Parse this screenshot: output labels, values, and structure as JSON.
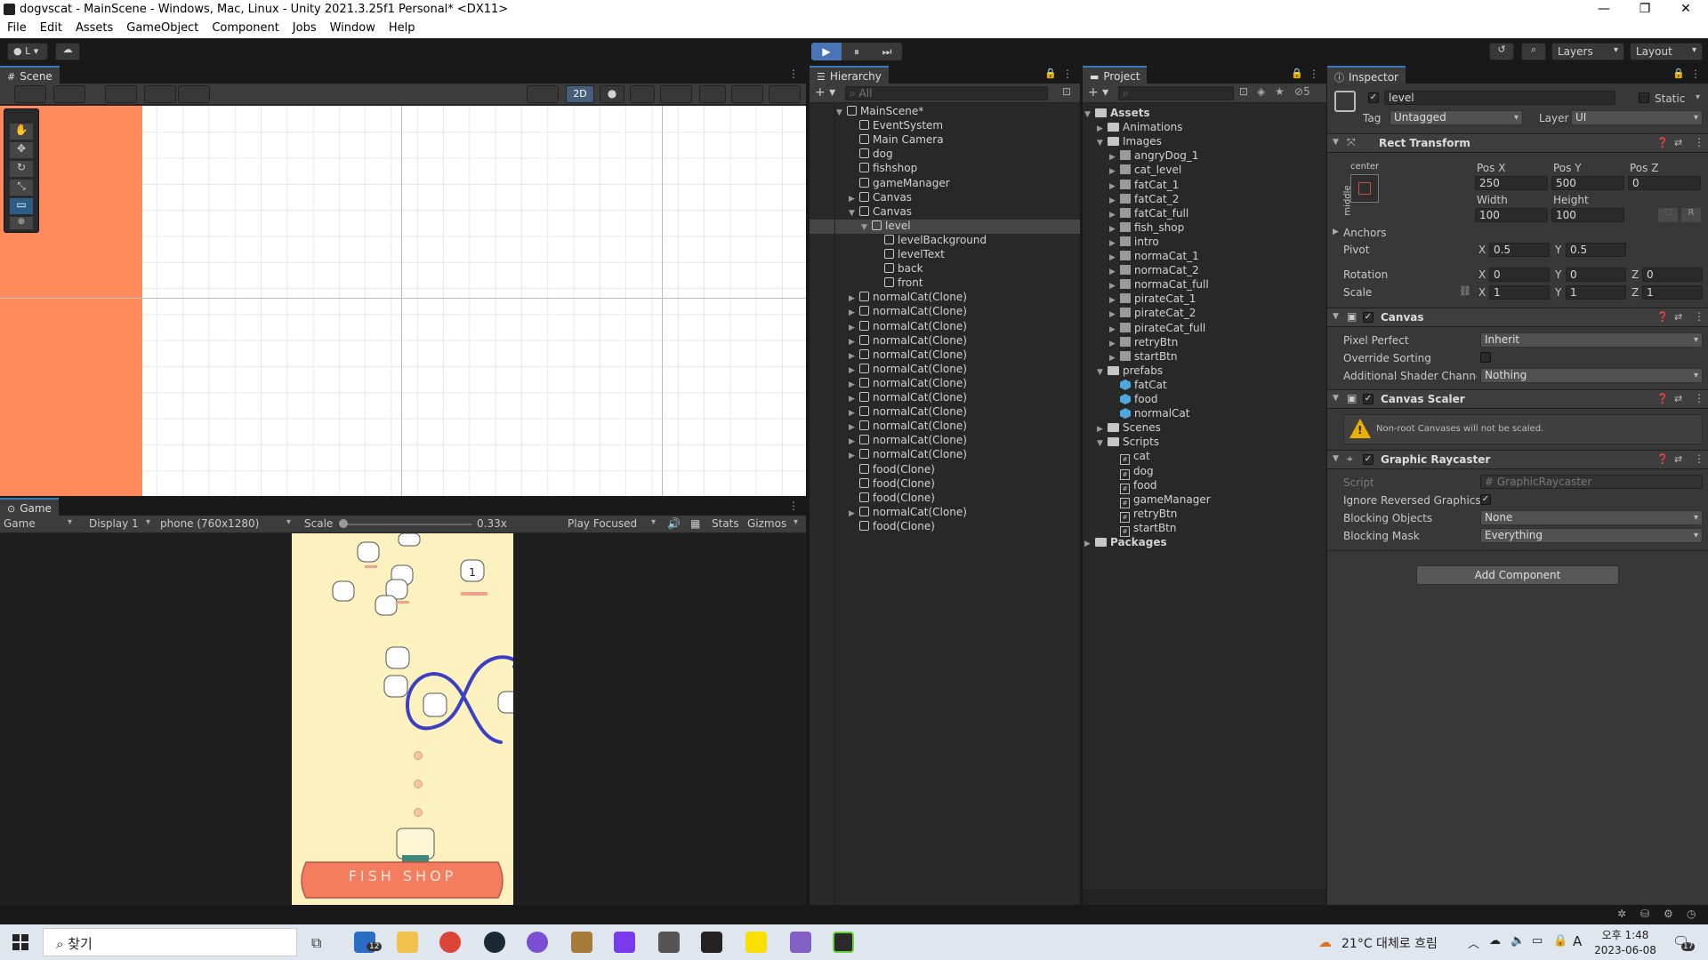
{
  "window": {
    "title": "dogvscat - MainScene - Windows, Mac, Linux - Unity 2021.3.25f1 Personal* <DX11>",
    "controls": [
      "—",
      "❐",
      "✕"
    ]
  },
  "menu": [
    "File",
    "Edit",
    "Assets",
    "GameObject",
    "Component",
    "Jobs",
    "Window",
    "Help"
  ],
  "toolbar": {
    "account": "L",
    "play": "▶",
    "pause": "⏸",
    "step": "⏭",
    "layers": "Layers",
    "layout": "Layout"
  },
  "scene": {
    "tab": "Scene",
    "mode_2d": "2D"
  },
  "game": {
    "tab": "Game",
    "view": "Game",
    "display": "Display 1",
    "resolution": "phone (760x1280)",
    "scale_label": "Scale",
    "scale_value": "0.33x",
    "play_focused": "Play Focused",
    "stats": "Stats",
    "gizmos": "Gizmos",
    "score": "1",
    "shop_label": "FISH   SHOP"
  },
  "hierarchy": {
    "tab": "Hierarchy",
    "search_placeholder": "All",
    "items": [
      {
        "label": "MainScene*",
        "depth": 0,
        "type": "scene",
        "expanded": true
      },
      {
        "label": "EventSystem",
        "depth": 1,
        "type": "go"
      },
      {
        "label": "Main Camera",
        "depth": 1,
        "type": "go"
      },
      {
        "label": "dog",
        "depth": 1,
        "type": "go"
      },
      {
        "label": "fishshop",
        "depth": 1,
        "type": "go"
      },
      {
        "label": "gameManager",
        "depth": 1,
        "type": "go"
      },
      {
        "label": "Canvas",
        "depth": 1,
        "type": "go",
        "collapsed": true
      },
      {
        "label": "Canvas",
        "depth": 1,
        "type": "go",
        "expanded": true
      },
      {
        "label": "level",
        "depth": 2,
        "type": "go",
        "expanded": true,
        "selected": true
      },
      {
        "label": "levelBackground",
        "depth": 3,
        "type": "go"
      },
      {
        "label": "levelText",
        "depth": 3,
        "type": "go"
      },
      {
        "label": "back",
        "depth": 3,
        "type": "go"
      },
      {
        "label": "front",
        "depth": 3,
        "type": "go"
      },
      {
        "label": "normalCat(Clone)",
        "depth": 1,
        "type": "go",
        "collapsed": true
      },
      {
        "label": "normalCat(Clone)",
        "depth": 1,
        "type": "go",
        "collapsed": true
      },
      {
        "label": "normalCat(Clone)",
        "depth": 1,
        "type": "go",
        "collapsed": true
      },
      {
        "label": "normalCat(Clone)",
        "depth": 1,
        "type": "go",
        "collapsed": true
      },
      {
        "label": "normalCat(Clone)",
        "depth": 1,
        "type": "go",
        "collapsed": true
      },
      {
        "label": "normalCat(Clone)",
        "depth": 1,
        "type": "go",
        "collapsed": true
      },
      {
        "label": "normalCat(Clone)",
        "depth": 1,
        "type": "go",
        "collapsed": true
      },
      {
        "label": "normalCat(Clone)",
        "depth": 1,
        "type": "go",
        "collapsed": true
      },
      {
        "label": "normalCat(Clone)",
        "depth": 1,
        "type": "go",
        "collapsed": true
      },
      {
        "label": "normalCat(Clone)",
        "depth": 1,
        "type": "go",
        "collapsed": true
      },
      {
        "label": "normalCat(Clone)",
        "depth": 1,
        "type": "go",
        "collapsed": true
      },
      {
        "label": "normalCat(Clone)",
        "depth": 1,
        "type": "go",
        "collapsed": true
      },
      {
        "label": "food(Clone)",
        "depth": 1,
        "type": "go"
      },
      {
        "label": "food(Clone)",
        "depth": 1,
        "type": "go"
      },
      {
        "label": "food(Clone)",
        "depth": 1,
        "type": "go"
      },
      {
        "label": "normalCat(Clone)",
        "depth": 1,
        "type": "go",
        "collapsed": true
      },
      {
        "label": "food(Clone)",
        "depth": 1,
        "type": "go"
      }
    ]
  },
  "project": {
    "tab": "Project",
    "badge": "5",
    "items": [
      {
        "label": "Assets",
        "depth": 0,
        "type": "folder",
        "expanded": true,
        "bold": true
      },
      {
        "label": "Animations",
        "depth": 1,
        "type": "folder",
        "collapsed": true
      },
      {
        "label": "Images",
        "depth": 1,
        "type": "folder",
        "expanded": true
      },
      {
        "label": "angryDog_1",
        "depth": 2,
        "type": "img",
        "collapsed": true
      },
      {
        "label": "cat_level",
        "depth": 2,
        "type": "img",
        "collapsed": true
      },
      {
        "label": "fatCat_1",
        "depth": 2,
        "type": "img",
        "collapsed": true
      },
      {
        "label": "fatCat_2",
        "depth": 2,
        "type": "img",
        "collapsed": true
      },
      {
        "label": "fatCat_full",
        "depth": 2,
        "type": "img",
        "collapsed": true
      },
      {
        "label": "fish_shop",
        "depth": 2,
        "type": "img",
        "collapsed": true
      },
      {
        "label": "intro",
        "depth": 2,
        "type": "img",
        "collapsed": true
      },
      {
        "label": "normaCat_1",
        "depth": 2,
        "type": "img",
        "collapsed": true
      },
      {
        "label": "normaCat_2",
        "depth": 2,
        "type": "img",
        "collapsed": true
      },
      {
        "label": "normaCat_full",
        "depth": 2,
        "type": "img",
        "collapsed": true
      },
      {
        "label": "pirateCat_1",
        "depth": 2,
        "type": "img",
        "collapsed": true
      },
      {
        "label": "pirateCat_2",
        "depth": 2,
        "type": "img",
        "collapsed": true
      },
      {
        "label": "pirateCat_full",
        "depth": 2,
        "type": "img",
        "collapsed": true
      },
      {
        "label": "retryBtn",
        "depth": 2,
        "type": "img",
        "collapsed": true
      },
      {
        "label": "startBtn",
        "depth": 2,
        "type": "img",
        "collapsed": true
      },
      {
        "label": "prefabs",
        "depth": 1,
        "type": "folder",
        "expanded": true
      },
      {
        "label": "fatCat",
        "depth": 2,
        "type": "prefab"
      },
      {
        "label": "food",
        "depth": 2,
        "type": "prefab"
      },
      {
        "label": "normalCat",
        "depth": 2,
        "type": "prefab"
      },
      {
        "label": "Scenes",
        "depth": 1,
        "type": "folder",
        "collapsed": true
      },
      {
        "label": "Scripts",
        "depth": 1,
        "type": "folder",
        "expanded": true
      },
      {
        "label": "cat",
        "depth": 2,
        "type": "script"
      },
      {
        "label": "dog",
        "depth": 2,
        "type": "script"
      },
      {
        "label": "food",
        "depth": 2,
        "type": "script"
      },
      {
        "label": "gameManager",
        "depth": 2,
        "type": "script"
      },
      {
        "label": "retryBtn",
        "depth": 2,
        "type": "script"
      },
      {
        "label": "startBtn",
        "depth": 2,
        "type": "script"
      },
      {
        "label": "Packages",
        "depth": 0,
        "type": "folder",
        "collapsed": true,
        "bold": true
      }
    ]
  },
  "inspector": {
    "tab": "Inspector",
    "object_name": "level",
    "static_label": "Static",
    "tag_label": "Tag",
    "tag_value": "Untagged",
    "layer_label": "Layer",
    "layer_value": "UI",
    "rect_transform": {
      "title": "Rect Transform",
      "anchor_h": "center",
      "anchor_v": "middle",
      "posx_label": "Pos X",
      "posx": "250",
      "posy_label": "Pos Y",
      "posy": "500",
      "posz_label": "Pos Z",
      "posz": "0",
      "width_label": "Width",
      "width": "100",
      "height_label": "Height",
      "height": "100",
      "anchors_label": "Anchors",
      "pivot_label": "Pivot",
      "pivot_x": "0.5",
      "pivot_y": "0.5",
      "rotation_label": "Rotation",
      "rot_x": "0",
      "rot_y": "0",
      "rot_z": "0",
      "scale_label": "Scale",
      "scale_x": "1",
      "scale_y": "1",
      "scale_z": "1",
      "x": "X",
      "y": "Y",
      "z": "Z",
      "r": "R"
    },
    "canvas": {
      "title": "Canvas",
      "pixel_perfect_label": "Pixel Perfect",
      "pixel_perfect": "Inherit",
      "override_sorting_label": "Override Sorting",
      "shader_channels_label": "Additional Shader Channels",
      "shader_channels": "Nothing"
    },
    "canvas_scaler": {
      "title": "Canvas Scaler",
      "warning": "Non-root Canvases will not be scaled."
    },
    "graphic_raycaster": {
      "title": "Graphic Raycaster",
      "script_label": "Script",
      "script": "GraphicRaycaster",
      "ignore_reversed_label": "Ignore Reversed Graphics",
      "blocking_objects_label": "Blocking Objects",
      "blocking_objects": "None",
      "blocking_mask_label": "Blocking Mask",
      "blocking_mask": "Everything"
    },
    "add_component": "Add Component"
  },
  "taskbar": {
    "search": "찾기",
    "mail_badge": "12",
    "weather": "21°C 대체로 흐림",
    "ime": "A",
    "time": "오후 1:48",
    "date": "2023-06-08",
    "notif_badge": "17"
  },
  "colors": {
    "accent": "#3a79bb",
    "selection": "#2c5d87",
    "play_active": "#4a74b5",
    "scene_orange": "#ff8a5c",
    "game_bg": "#fdf1c0",
    "shop_red": "#f47d5f",
    "path_blue": "#3b3fc4"
  }
}
